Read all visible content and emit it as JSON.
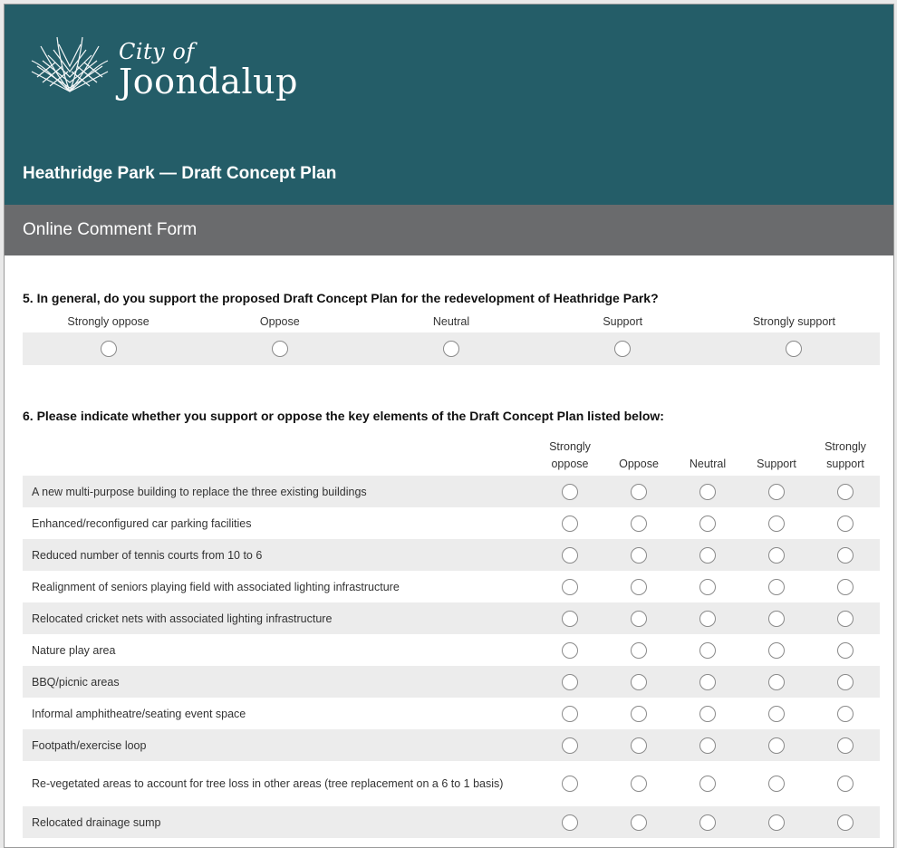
{
  "header": {
    "logo_line1": "City of",
    "logo_line2": "Joondalup",
    "survey_title": "Heathridge Park — Draft Concept Plan",
    "subtitle": "Online Comment Form"
  },
  "q5": {
    "title": "5. In general, do you support the proposed Draft Concept Plan for the redevelopment of Heathridge Park?",
    "options": [
      "Strongly oppose",
      "Oppose",
      "Neutral",
      "Support",
      "Strongly support"
    ]
  },
  "q6": {
    "title": "6. Please indicate whether you support or oppose the key elements of the Draft Concept Plan listed below:",
    "columns": [
      {
        "line1": "Strongly",
        "line2": "oppose"
      },
      {
        "line1": "",
        "line2": "Oppose"
      },
      {
        "line1": "",
        "line2": "Neutral"
      },
      {
        "line1": "",
        "line2": "Support"
      },
      {
        "line1": "Strongly",
        "line2": "support"
      }
    ],
    "rows": [
      "A new multi-purpose building to replace the three existing buildings",
      "Enhanced/reconfigured car parking facilities",
      "Reduced number of tennis courts from 10 to 6",
      "Realignment of seniors playing field with associated lighting infrastructure",
      "Relocated cricket nets with associated lighting infrastructure",
      "Nature play area",
      "BBQ/picnic areas",
      "Informal amphitheatre/seating event space",
      "Footpath/exercise loop",
      "Re-vegetated areas to account for tree loss in other areas (tree replacement on a 6 to 1 basis)",
      "Relocated drainage sump"
    ]
  },
  "colors": {
    "header_bg": "#245d68",
    "subheader_bg": "#6a6b6d",
    "row_shade": "#ececec"
  }
}
